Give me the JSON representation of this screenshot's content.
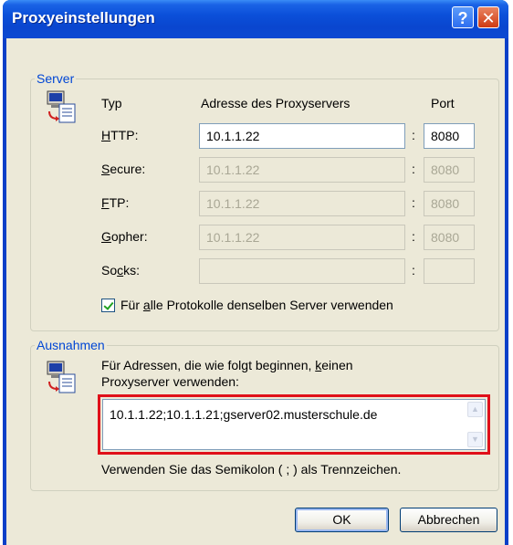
{
  "window": {
    "title": "Proxyeinstellungen",
    "help_label": "?",
    "close_label": "✕"
  },
  "server": {
    "legend": "Server",
    "icon": "network-computers-icon",
    "headers": {
      "type": "Typ",
      "address": "Adresse des Proxyservers",
      "port": "Port"
    },
    "rows": [
      {
        "label_pre": "",
        "label_acc": "H",
        "label_post": "TTP:",
        "address": "10.1.1.22",
        "port": "8080",
        "enabled": true
      },
      {
        "label_pre": "",
        "label_acc": "S",
        "label_post": "ecure:",
        "address": "10.1.1.22",
        "port": "8080",
        "enabled": false
      },
      {
        "label_pre": "",
        "label_acc": "F",
        "label_post": "TP:",
        "address": "10.1.1.22",
        "port": "8080",
        "enabled": false
      },
      {
        "label_pre": "",
        "label_acc": "G",
        "label_post": "opher:",
        "address": "10.1.1.22",
        "port": "8080",
        "enabled": false
      },
      {
        "label_pre": "So",
        "label_acc": "c",
        "label_post": "ks:",
        "address": "",
        "port": "",
        "enabled": false
      }
    ],
    "colon": ":",
    "same_server": {
      "checked": true,
      "pre": "Für ",
      "acc": "a",
      "post": "lle Protokolle denselben Server verwenden"
    }
  },
  "exceptions": {
    "legend": "Ausnahmen",
    "icon": "network-computers-icon",
    "desc_line1_pre": "Für Adressen, die wie folgt beginnen, ",
    "desc_line1_acc": "k",
    "desc_line1_post": "einen",
    "desc_line2": "Proxyserver verwenden:",
    "value": "10.1.1.22;10.1.1.21;gserver02.musterschule.de",
    "highlight_color": "#e0101a",
    "hint": "Verwenden Sie das Semikolon ( ; ) als Trennzeichen."
  },
  "buttons": {
    "ok": "OK",
    "cancel": "Abbrechen"
  }
}
